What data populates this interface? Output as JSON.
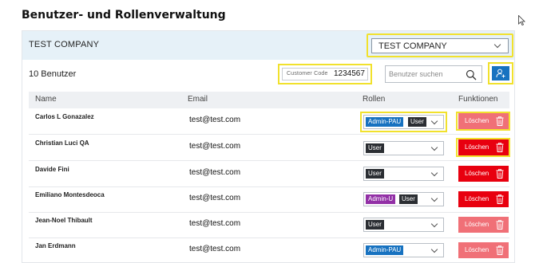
{
  "page": {
    "title": "Benutzer- und Rollenverwaltung"
  },
  "company_bar": {
    "name": "TEST COMPANY",
    "selected_company": "TEST COMPANY"
  },
  "toolbar": {
    "user_count": "10 Benutzer",
    "customer_code_label": "Customer Code",
    "customer_code_value": "1234567",
    "search_placeholder": "Benutzer suchen"
  },
  "table": {
    "headers": {
      "name": "Name",
      "email": "Email",
      "roles": "Rollen",
      "functions": "Funktionen"
    },
    "rows": [
      {
        "name": "Carlos L Gonazalez",
        "email": "test@test.com",
        "roles": [
          "Admin-PAU",
          "User"
        ],
        "delete_label": "Löschen"
      },
      {
        "name": "Christian Luci QA",
        "email": "test@test.com",
        "roles": [
          "User"
        ],
        "delete_label": "Löschen"
      },
      {
        "name": "Davide Fini",
        "email": "test@test.com",
        "roles": [
          "User"
        ],
        "delete_label": "Löschen"
      },
      {
        "name": "Emiliano Montesdeoca",
        "email": "test@test.com",
        "roles": [
          "Admin-U",
          "User"
        ],
        "delete_label": "Löschen"
      },
      {
        "name": "Jean-Noel Thibault",
        "email": "test@test.com",
        "roles": [
          "User"
        ],
        "delete_label": "Löschen"
      },
      {
        "name": "Jan Erdmann",
        "email": "test@test.com",
        "roles": [
          "Admin-PAU"
        ],
        "delete_label": "Löschen"
      }
    ]
  },
  "colors": {
    "highlight": "#f1e12d",
    "primary_blue": "#1772c0",
    "delete_red": "#e8000f",
    "delete_red_muted": "#f07077",
    "role_purple": "#9230a6",
    "role_dark": "#2b2e33"
  }
}
